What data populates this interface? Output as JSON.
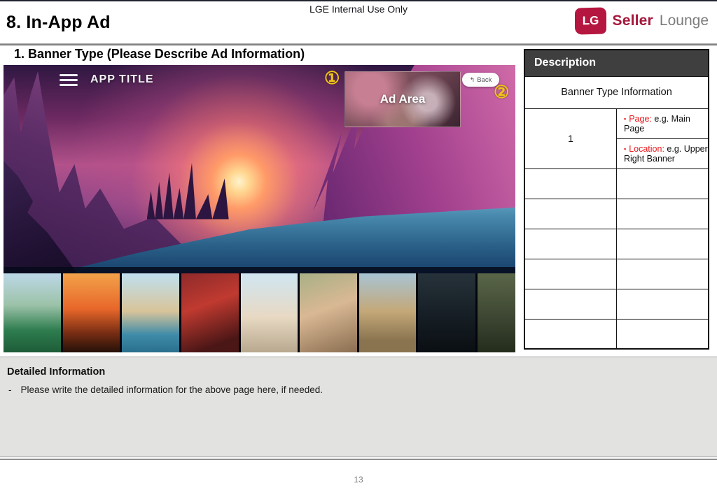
{
  "page": {
    "header_note": "LGE Internal Use Only",
    "title": "8. In-App Ad",
    "page_number": "13"
  },
  "logo": {
    "lg": "LG",
    "brand_bold": "Seller",
    "brand_light": "Lounge"
  },
  "section": {
    "heading": "1. Banner Type (Please Describe Ad Information)"
  },
  "app_preview": {
    "app_title": "APP TITLE",
    "ad_area_label": "Ad Area",
    "back_button": {
      "icon_glyph": "↰",
      "label": "Back"
    },
    "marker_1": "①",
    "marker_2": "②",
    "thumbnails": [
      "soccer-player",
      "dinosaurs-sunset",
      "venice-canal",
      "motocross-rider",
      "couple-beach",
      "woman-headphones",
      "desert-ruins",
      "detective-man",
      "horse-rider"
    ]
  },
  "description_table": {
    "header": "Description",
    "subheader": "Banner Type Information",
    "row1": {
      "num": "1",
      "details": [
        {
          "bullet": "▪",
          "label": "Page:",
          "value": "e.g. Main Page"
        },
        {
          "bullet": "▪",
          "label": "Location:",
          "value": "e.g. Upper Right Banner"
        }
      ]
    },
    "empty_row_count": 6
  },
  "detailed_info": {
    "heading": "Detailed Information",
    "dash": "-",
    "body": "Please write the detailed information for the above page here, if needed."
  },
  "colors": {
    "lg_crimson": "#b5163f",
    "accent_red": "#e8191e",
    "table_header_bg": "#3f3f3f",
    "marker_yellow": "#f0c419",
    "panel_gray": "#e2e2e0"
  }
}
